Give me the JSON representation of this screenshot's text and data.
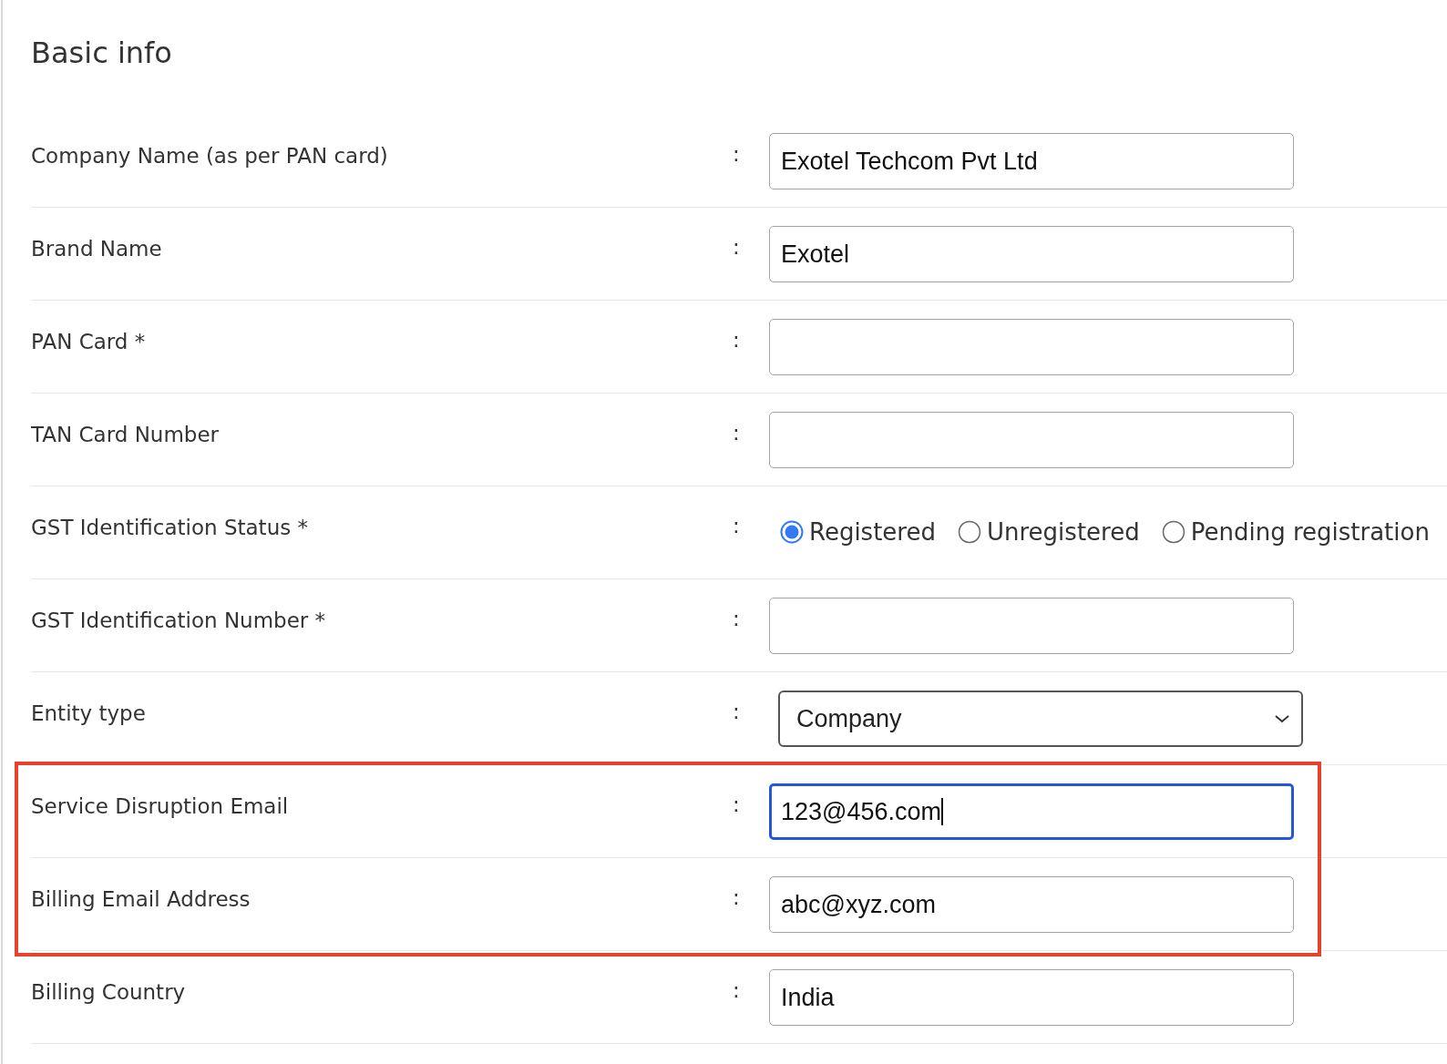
{
  "title": "Basic info",
  "rows": [
    {
      "kind": "text",
      "label": "Company Name (as per PAN card)",
      "separator": ":",
      "value": "Exotel Techcom Pvt Ltd",
      "focused": false,
      "highlighted": false
    },
    {
      "kind": "text",
      "label": "Brand Name",
      "separator": ":",
      "value": "Exotel",
      "focused": false,
      "highlighted": false
    },
    {
      "kind": "text",
      "label": "PAN Card *",
      "separator": ":",
      "focused": false,
      "highlighted": false
    },
    {
      "kind": "text",
      "label": "TAN Card Number",
      "separator": ":",
      "focused": false,
      "highlighted": false
    },
    {
      "kind": "radio",
      "label": "GST Identification Status *",
      "separator": ":",
      "highlighted": false,
      "options": [
        {
          "label": "Registered",
          "selected": true
        },
        {
          "label": "Unregistered",
          "selected": false
        },
        {
          "label": "Pending registration",
          "selected": false
        }
      ]
    },
    {
      "kind": "text",
      "label": "GST Identification Number *",
      "separator": ":",
      "focused": false,
      "highlighted": false
    },
    {
      "kind": "select",
      "label": "Entity type",
      "separator": ":",
      "value": "Company",
      "highlighted": false
    },
    {
      "kind": "text",
      "label": "Service Disruption Email",
      "separator": ":",
      "value": "123@456.com",
      "focused": true,
      "highlighted": true
    },
    {
      "kind": "text",
      "label": "Billing Email Address",
      "separator": ":",
      "value": "abc@xyz.com",
      "focused": false,
      "highlighted": true
    },
    {
      "kind": "text",
      "label": "Billing Country",
      "separator": ":",
      "value": "India",
      "focused": false,
      "highlighted": false
    }
  ]
}
